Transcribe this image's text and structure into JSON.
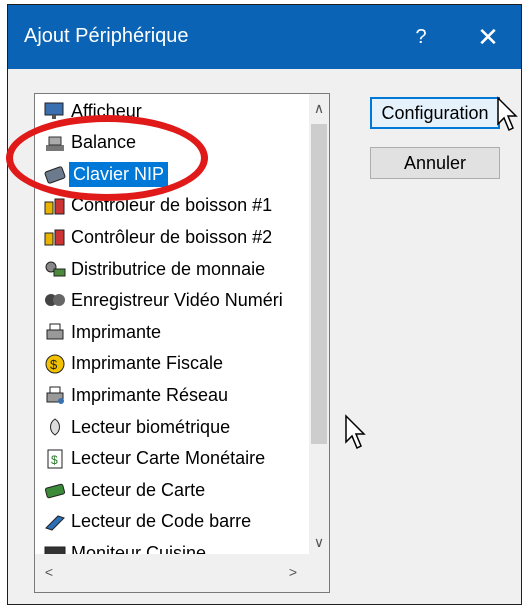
{
  "window": {
    "title": "Ajout Périphérique",
    "help_label": "?",
    "close_label": "✕"
  },
  "list": {
    "items": [
      {
        "label": "Afficheur",
        "icon": "display-icon"
      },
      {
        "label": "Balance",
        "icon": "scale-icon"
      },
      {
        "label": "Clavier NIP",
        "icon": "pinpad-icon",
        "selected": true
      },
      {
        "label": "Contrôleur de boisson #1",
        "icon": "drink-controller-icon"
      },
      {
        "label": "Contrôleur de boisson #2",
        "icon": "drink-controller-icon"
      },
      {
        "label": "Distributrice de monnaie",
        "icon": "coin-dispenser-icon"
      },
      {
        "label": "Enregistreur Vidéo Numéri",
        "icon": "dvr-icon"
      },
      {
        "label": "Imprimante",
        "icon": "printer-icon"
      },
      {
        "label": "Imprimante Fiscale",
        "icon": "fiscal-printer-icon"
      },
      {
        "label": "Imprimante Réseau",
        "icon": "network-printer-icon"
      },
      {
        "label": "Lecteur biométrique",
        "icon": "biometric-reader-icon"
      },
      {
        "label": "Lecteur Carte Monétaire",
        "icon": "money-card-reader-icon"
      },
      {
        "label": "Lecteur de Carte",
        "icon": "card-reader-icon"
      },
      {
        "label": "Lecteur de Code barre",
        "icon": "barcode-reader-icon"
      },
      {
        "label": "Moniteur Cuisine",
        "icon": "kitchen-monitor-icon"
      }
    ]
  },
  "buttons": {
    "configuration": "Configuration",
    "cancel": "Annuler"
  },
  "colors": {
    "titlebar": "#0a63b4",
    "selection": "#0078d7",
    "annotation": "#e01919"
  }
}
